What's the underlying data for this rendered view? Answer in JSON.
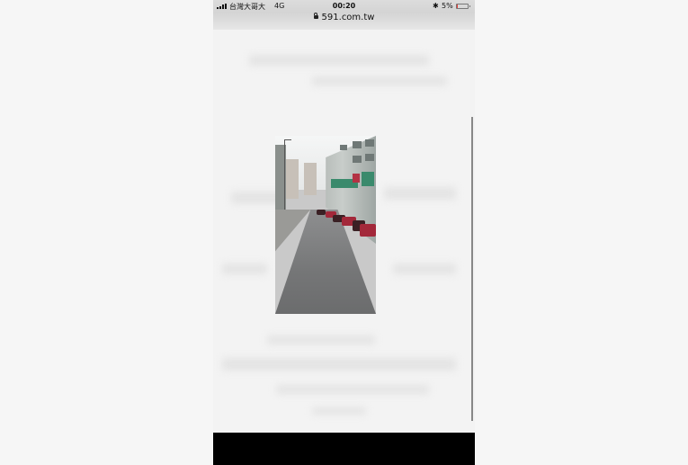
{
  "status_bar": {
    "carrier": "台灣大哥大",
    "network": "4G",
    "time": "00:20",
    "battery_percent": "5%",
    "bluetooth_icon": "bluetooth-icon",
    "signal_icon": "signal-bars-icon",
    "battery_icon": "battery-icon",
    "battery_level": 0.05,
    "battery_color": "#e53935"
  },
  "url_bar": {
    "url": "591.com.tw",
    "lock_icon": "lock-icon"
  },
  "content": {
    "photo": {
      "type": "street-photo"
    }
  }
}
